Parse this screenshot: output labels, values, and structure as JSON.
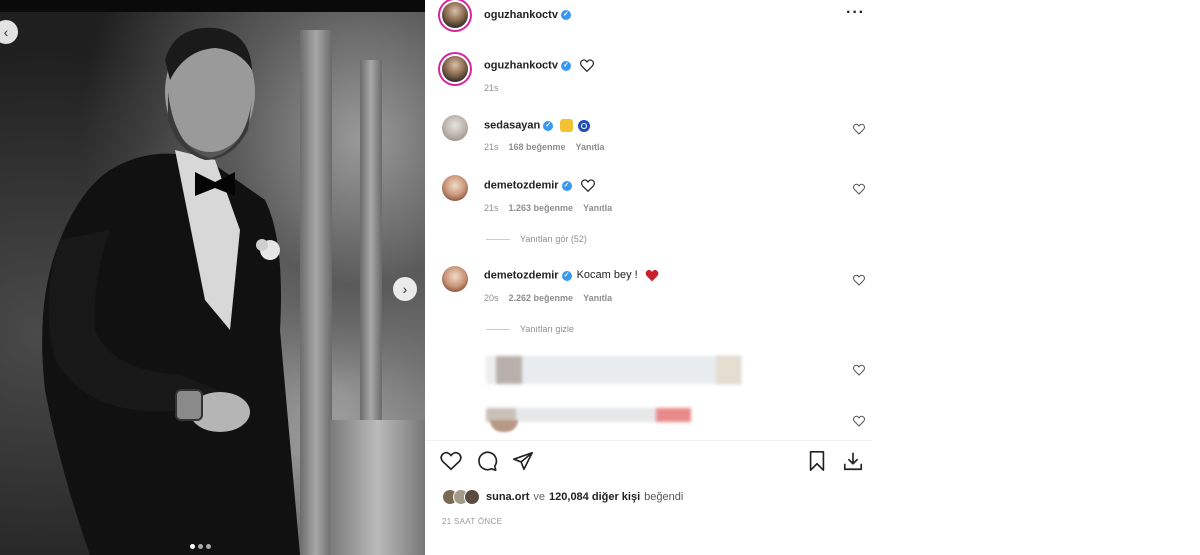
{
  "post": {
    "author": "oguzhankoctv",
    "caption_time": "21s",
    "more_icon": "more-horizontal-icon"
  },
  "comments": [
    {
      "user": "sedasayan",
      "text": "",
      "time": "21s",
      "likes": "168 beğenme",
      "reply": "Yanıtla"
    },
    {
      "user": "demetozdemir",
      "text": "",
      "time": "21s",
      "likes": "1.263 beğenme",
      "reply": "Yanıtla",
      "view_replies": "Yanıtları gör (52)"
    },
    {
      "user": "demetozdemir",
      "text": "Kocam bey !",
      "time": "20s",
      "likes": "2.262 beğenme",
      "reply": "Yanıtla",
      "hide_replies": "Yanıtları gizle"
    }
  ],
  "likes_bar": {
    "user": "suna.ort",
    "connector": "ve",
    "count_text": "120,084 diğer kişi",
    "suffix": "beğendi"
  },
  "timestamp": "21 SAAT ÖNCE",
  "colors": {
    "verified": "#3897f0",
    "heart_red": "#ed4956",
    "story_ring": "#d6249f"
  }
}
